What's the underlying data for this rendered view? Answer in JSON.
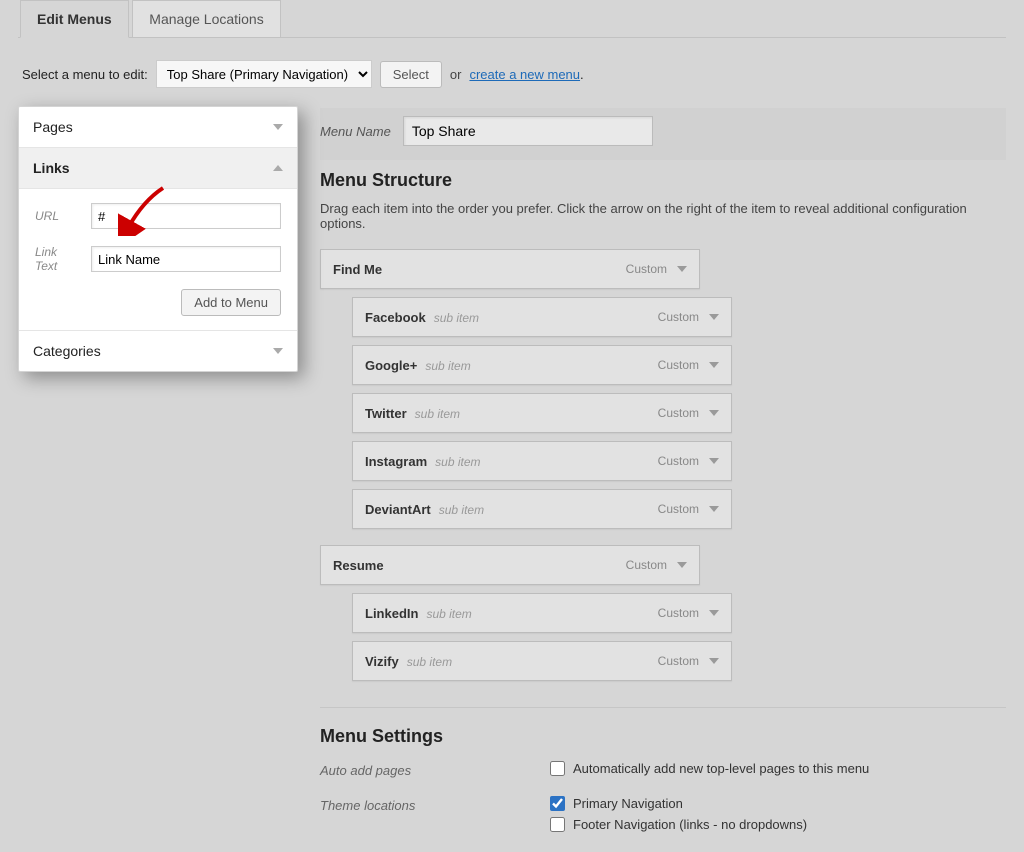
{
  "tabs": {
    "edit": "Edit Menus",
    "manage": "Manage Locations"
  },
  "selectbar": {
    "label": "Select a menu to edit:",
    "selected": "Top Share (Primary Navigation)",
    "select_btn": "Select",
    "or": "or",
    "create_link": "create a new menu",
    "period": "."
  },
  "sidebar": {
    "pages": "Pages",
    "links": "Links",
    "url_label": "URL",
    "url_value": "#",
    "linktext_label": "Link Text",
    "linktext_value": "Link Name",
    "add_btn": "Add to Menu",
    "categories": "Categories"
  },
  "main": {
    "menu_name_label": "Menu Name",
    "menu_name_value": "Top Share",
    "structure_heading": "Menu Structure",
    "structure_help": "Drag each item into the order you prefer. Click the arrow on the right of the item to reveal additional configuration options.",
    "subitem_text": "sub item",
    "type_label": "Custom",
    "items": [
      {
        "title": "Find Me",
        "level": 0,
        "sub": false
      },
      {
        "title": "Facebook",
        "level": 1,
        "sub": true
      },
      {
        "title": "Google+",
        "level": 1,
        "sub": true
      },
      {
        "title": "Twitter",
        "level": 1,
        "sub": true
      },
      {
        "title": "Instagram",
        "level": 1,
        "sub": true
      },
      {
        "title": "DeviantArt",
        "level": 1,
        "sub": true
      },
      {
        "title": "Resume",
        "level": 0,
        "sub": false
      },
      {
        "title": "LinkedIn",
        "level": 1,
        "sub": true
      },
      {
        "title": "Vizify",
        "level": 1,
        "sub": true
      }
    ],
    "settings_heading": "Menu Settings",
    "auto_add_label": "Auto add pages",
    "auto_add_text": "Automatically add new top-level pages to this menu",
    "theme_loc_label": "Theme locations",
    "theme_loc_primary": "Primary Navigation",
    "theme_loc_footer": "Footer Navigation (links - no dropdowns)"
  }
}
